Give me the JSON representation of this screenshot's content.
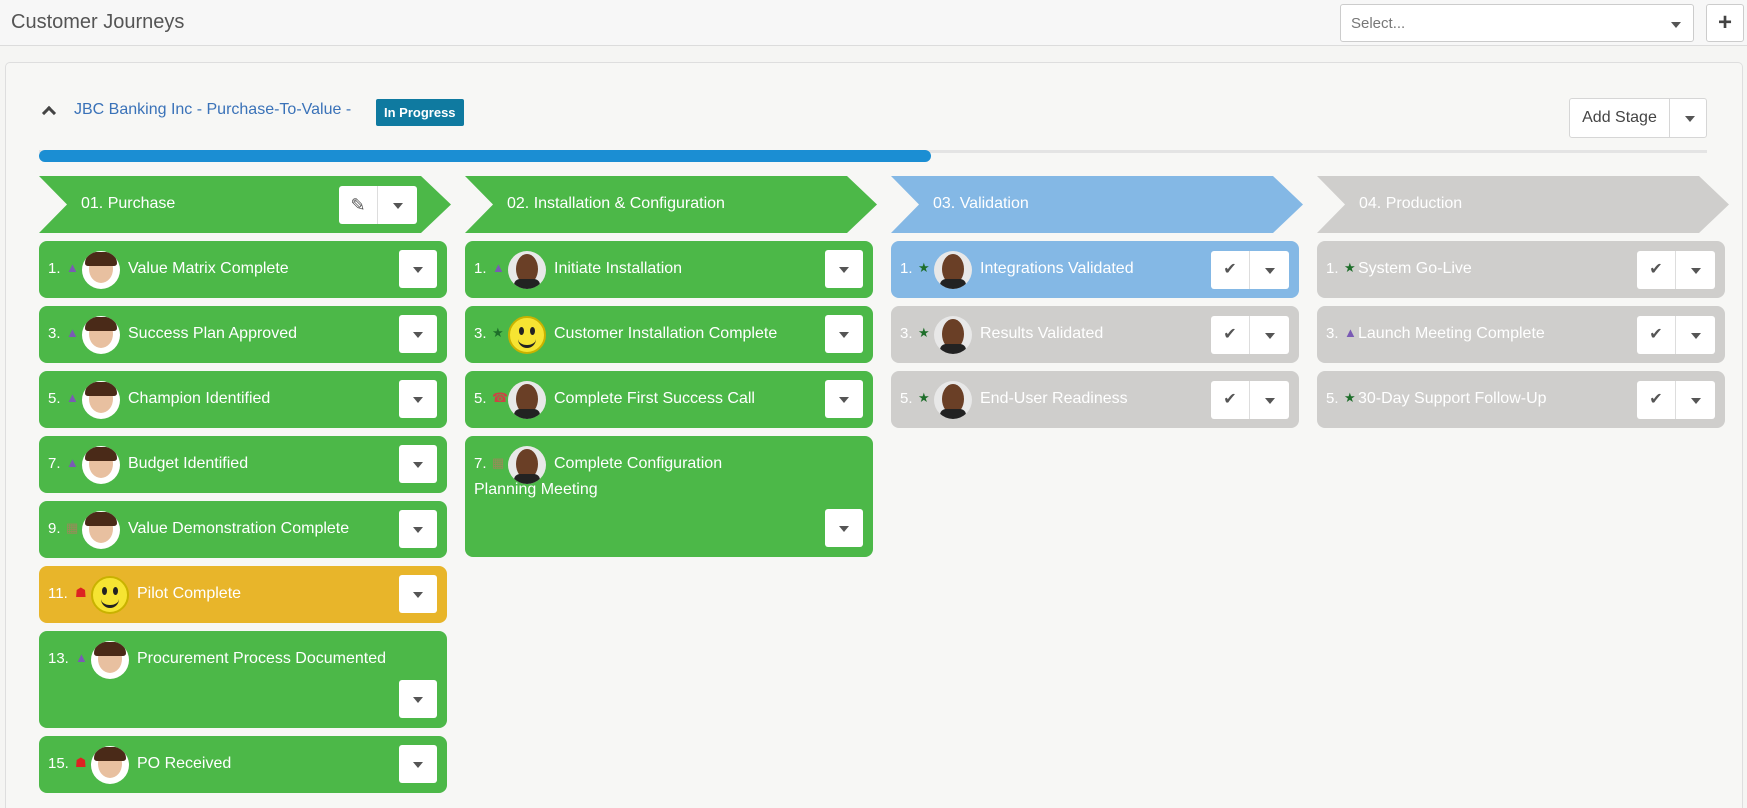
{
  "header": {
    "title": "Customer Journeys",
    "select_placeholder": "Select...",
    "add_glyph": "+"
  },
  "journey": {
    "title": "JBC Banking Inc - Purchase-To-Value -",
    "status": "In Progress",
    "add_stage_label": "Add Stage",
    "progress": 0.535
  },
  "colors": {
    "green": "#4cb848",
    "yellow": "#e8b52a",
    "blue": "#84b8e5",
    "grey": "#cfcecc",
    "progress": "#1b8ed3",
    "badge": "#0f7aa0"
  },
  "stages": [
    {
      "label": "01. Purchase",
      "color": "#4cb848",
      "editable": true,
      "tasks": [
        {
          "num": "1.",
          "icon": "person-icon",
          "avatar": "woman",
          "title": "Value Matrix Complete",
          "color": "green"
        },
        {
          "num": "3.",
          "icon": "person-icon",
          "avatar": "woman",
          "title": "Success Plan Approved",
          "color": "green"
        },
        {
          "num": "5.",
          "icon": "person-icon",
          "avatar": "woman",
          "title": "Champion Identified",
          "color": "green"
        },
        {
          "num": "7.",
          "icon": "person-icon",
          "avatar": "woman",
          "title": "Budget Identified",
          "color": "green"
        },
        {
          "num": "9.",
          "icon": "calendar-icon",
          "avatar": "woman",
          "title": "Value Demonstration Complete",
          "color": "green"
        },
        {
          "num": "11.",
          "icon": "trophy-icon",
          "avatar": "smiley",
          "title": "Pilot Complete",
          "color": "yellow"
        },
        {
          "num": "13.",
          "icon": "person-icon",
          "avatar": "woman",
          "title": "Procurement Process Documented",
          "color": "green"
        },
        {
          "num": "15.",
          "icon": "trophy-icon",
          "avatar": "woman",
          "title": "PO Received",
          "color": "green"
        }
      ]
    },
    {
      "label": "02. Installation & Configuration",
      "color": "#4cb848",
      "editable": false,
      "tasks": [
        {
          "num": "1.",
          "icon": "person-icon",
          "avatar": "man",
          "title": "Initiate Installation",
          "color": "green"
        },
        {
          "num": "3.",
          "icon": "star-icon",
          "avatar": "smiley",
          "title": "Customer Installation Complete",
          "color": "green"
        },
        {
          "num": "5.",
          "icon": "phone-icon",
          "avatar": "man",
          "title": "Complete First Success Call",
          "color": "green"
        },
        {
          "num": "7.",
          "icon": "calendar-icon",
          "avatar": "man",
          "title": "Complete Configuration Planning Meeting",
          "color": "green"
        }
      ]
    },
    {
      "label": "03. Validation",
      "color": "#84b8e5",
      "editable": false,
      "tasks": [
        {
          "num": "1.",
          "icon": "star-icon",
          "avatar": "man",
          "title": "Integrations Validated",
          "color": "blue"
        },
        {
          "num": "3.",
          "icon": "star-icon",
          "avatar": "man",
          "title": "Results Validated",
          "color": "grey"
        },
        {
          "num": "5.",
          "icon": "star-icon",
          "avatar": "man",
          "title": "End-User Readiness",
          "color": "grey"
        }
      ]
    },
    {
      "label": "04. Production",
      "color": "#cfcecc",
      "editable": false,
      "tasks": [
        {
          "num": "1.",
          "icon": "star-icon",
          "avatar": "",
          "title": "System Go-Live",
          "color": "grey"
        },
        {
          "num": "3.",
          "icon": "person-icon",
          "avatar": "",
          "title": "Launch Meeting Complete",
          "color": "grey"
        },
        {
          "num": "5.",
          "icon": "star-icon",
          "avatar": "",
          "title": "30-Day Support Follow-Up",
          "color": "grey"
        }
      ]
    }
  ]
}
